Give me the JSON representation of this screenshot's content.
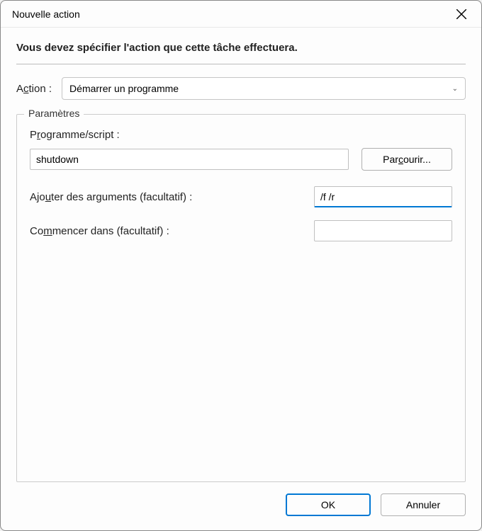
{
  "titlebar": {
    "title": "Nouvelle action"
  },
  "description": "Vous devez spécifier l'action que cette tâche effectuera.",
  "action": {
    "label_pre": "A",
    "label_u": "c",
    "label_post": "tion :",
    "selected": "Démarrer un programme"
  },
  "params": {
    "legend": "Paramètres",
    "program": {
      "label_pre": "P",
      "label_u": "r",
      "label_post": "ogramme/script :",
      "value": "shutdown",
      "browse_pre": "Par",
      "browse_u": "c",
      "browse_post": "ourir..."
    },
    "arguments": {
      "label_pre": "Ajo",
      "label_u": "u",
      "label_post": "ter des arguments (facultatif) :",
      "value": "/f /r"
    },
    "startin": {
      "label_pre": "Co",
      "label_u": "m",
      "label_post": "mencer dans (facultatif) :",
      "value": ""
    }
  },
  "footer": {
    "ok": "OK",
    "cancel": "Annuler"
  }
}
